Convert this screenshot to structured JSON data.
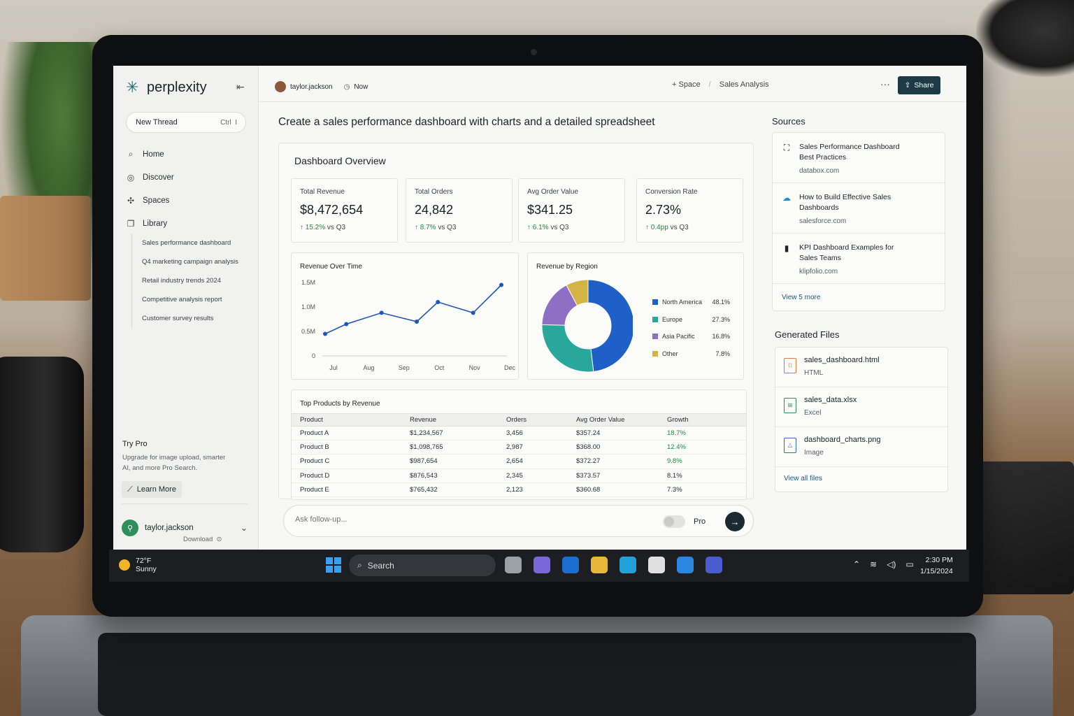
{
  "app": {
    "name": "perplexity",
    "collapse_icon": "collapse-icon"
  },
  "sidebar": {
    "new_thread": {
      "label": "New Thread",
      "shortcut": "Ctrl",
      "shortcut_key": "I"
    },
    "nav": [
      {
        "label": "Home",
        "icon": "search-icon"
      },
      {
        "label": "Discover",
        "icon": "globe-icon"
      },
      {
        "label": "Spaces",
        "icon": "spaces-icon"
      },
      {
        "label": "Library",
        "icon": "library-icon"
      }
    ],
    "library_items": [
      "Sales performance dashboard",
      "Q4 marketing campaign analysis",
      "Retail industry trends 2024",
      "Competitive analysis report",
      "Customer survey results"
    ],
    "try_pro": {
      "title": "Try Pro",
      "desc_line1": "Upgrade for image upload, smarter",
      "desc_line2": "AI, and more Pro Search.",
      "button": "Learn More"
    },
    "user": {
      "name": "taylor.jackson",
      "download": "Download"
    }
  },
  "topbar": {
    "user": "taylor.jackson",
    "time": "Now",
    "space": "+ Space",
    "sep": "/",
    "thread": "Sales Analysis",
    "more": "···",
    "share": "Share"
  },
  "main": {
    "question": "Create a sales performance dashboard with charts and a detailed spreadsheet",
    "dashboard_title": "Dashboard Overview",
    "kpis": [
      {
        "label": "Total Revenue",
        "value": "$8,472,654",
        "change": "↑ 15.2%",
        "suffix": "vs Q3"
      },
      {
        "label": "Total Orders",
        "value": "24,842",
        "change": "↑ 8.7%",
        "suffix": "vs Q3"
      },
      {
        "label": "Avg Order Value",
        "value": "$341.25",
        "change": "↑ 6.1%",
        "suffix": "vs Q3"
      },
      {
        "label": "Conversion Rate",
        "value": "2.73%",
        "change": "↑ 0.4pp",
        "suffix": "vs Q3"
      }
    ],
    "table": {
      "title": "Top Products by Revenue",
      "headers": [
        "Product",
        "Revenue",
        "Orders",
        "Avg Order Value",
        "Growth"
      ],
      "rows": [
        [
          "Product A",
          "$1,234,567",
          "3,456",
          "$357.24",
          "18.7%"
        ],
        [
          "Product B",
          "$1,098,765",
          "2,987",
          "$368.00",
          "12.4%"
        ],
        [
          "Product C",
          "$987,654",
          "2,654",
          "$372.27",
          "9.8%"
        ],
        [
          "Product D",
          "$876,543",
          "2,345",
          "$373.57",
          "8.1%"
        ],
        [
          "Product E",
          "$765,432",
          "2,123",
          "$360.68",
          "7.3%"
        ]
      ],
      "green_rows": 3
    },
    "ask": {
      "placeholder": "Ask follow-up...",
      "pro": "Pro"
    }
  },
  "chart_data": [
    {
      "type": "line",
      "title": "Revenue Over Time",
      "x_ticks": [
        "Jul",
        "Aug",
        "Sep",
        "Oct",
        "Nov",
        "Dec"
      ],
      "y_ticks": [
        "1.5M",
        "1.0M",
        "0.5M",
        "0"
      ],
      "x": [
        0,
        0.6,
        1.6,
        2.6,
        3.2,
        4.2,
        5.0
      ],
      "y": [
        0.45,
        0.65,
        0.88,
        0.7,
        1.1,
        0.88,
        1.45
      ],
      "ylim": [
        0,
        1.5
      ],
      "xlim": [
        0,
        5
      ],
      "color": "#1f56b8",
      "grid": false
    },
    {
      "type": "pie",
      "title": "Revenue by Region",
      "labels": [
        "North America",
        "Europe",
        "Asia Pacific",
        "Other"
      ],
      "values": [
        48.1,
        27.3,
        16.8,
        7.8
      ],
      "display": [
        "48.1%",
        "27.3%",
        "16.8%",
        "7.8%"
      ],
      "colors": [
        "#1f5fc8",
        "#2aa79b",
        "#8d6fc3",
        "#d4b445"
      ],
      "donut": true
    }
  ],
  "sources": {
    "title": "Sources",
    "items": [
      {
        "title_l1": "Sales Performance Dashboard",
        "title_l2": "Best Practices",
        "domain": "databox.com",
        "icon": "databox-icon"
      },
      {
        "title_l1": "How to Build Effective Sales",
        "title_l2": "Dashboards",
        "domain": "salesforce.com",
        "icon": "salesforce-icon"
      },
      {
        "title_l1": "KPI Dashboard Examples for",
        "title_l2": "Sales Teams",
        "domain": "klipfolio.com",
        "icon": "klipfolio-icon"
      }
    ],
    "view_more": "View 5 more"
  },
  "files": {
    "title": "Generated Files",
    "items": [
      {
        "name": "sales_dashboard.html",
        "type": "HTML",
        "color": "#e07b39"
      },
      {
        "name": "sales_data.xlsx",
        "type": "Excel",
        "color": "#2f8f5b"
      },
      {
        "name": "dashboard_charts.png",
        "type": "Image",
        "color": "#2f6fb8"
      }
    ],
    "view_all": "View all files"
  },
  "taskbar": {
    "temp": "72°F",
    "weather": "Sunny",
    "search": "Search",
    "time": "2:30 PM",
    "date": "1/15/2024",
    "apps": [
      "task-view-icon",
      "chat-icon",
      "outlook-icon",
      "file-explorer-icon",
      "edge-icon",
      "store-icon",
      "copilot-icon",
      "settings-icon"
    ],
    "app_colors": [
      "#9aa0a6",
      "#7b68d8",
      "#1b6fd1",
      "#e8b63a",
      "#22a1d8",
      "#e0e0e0",
      "#2b86e0",
      "#4a5cd0"
    ]
  }
}
